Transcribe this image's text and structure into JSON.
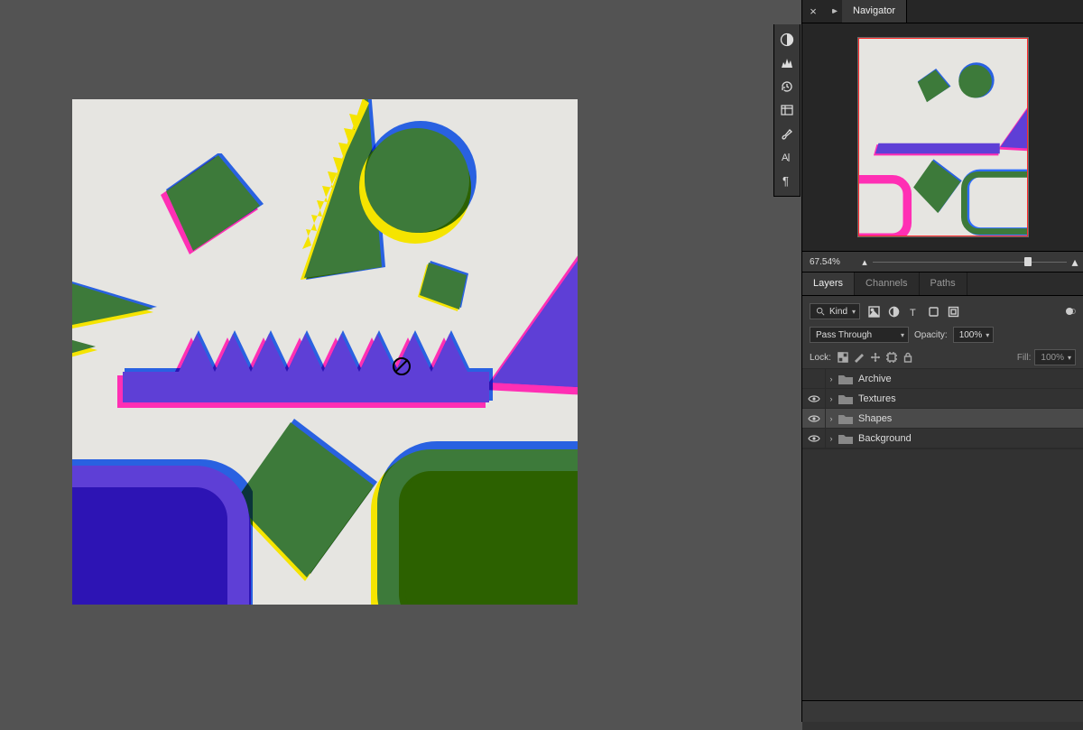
{
  "navigator": {
    "tab_label": "Navigator",
    "zoom_percent": "67.54%",
    "slider_position_pct": 78
  },
  "layers_panel": {
    "tabs": {
      "layers": "Layers",
      "channels": "Channels",
      "paths": "Paths"
    },
    "filter_label": "Kind",
    "blend_mode": "Pass Through",
    "opacity_label": "Opacity:",
    "opacity_value": "100%",
    "lock_label": "Lock:",
    "fill_label": "Fill:",
    "fill_value": "100%",
    "layers": [
      {
        "name": "Archive",
        "visible": false,
        "selected": false
      },
      {
        "name": "Textures",
        "visible": true,
        "selected": false
      },
      {
        "name": "Shapes",
        "visible": true,
        "selected": true
      },
      {
        "name": "Background",
        "visible": true,
        "selected": false
      }
    ]
  },
  "artwork_colors": {
    "yellow": "#f5e400",
    "magenta": "#ff2fb4",
    "cyan": "#2d6cff",
    "green": "#3d7a3a",
    "violet": "#5e3fd6"
  }
}
